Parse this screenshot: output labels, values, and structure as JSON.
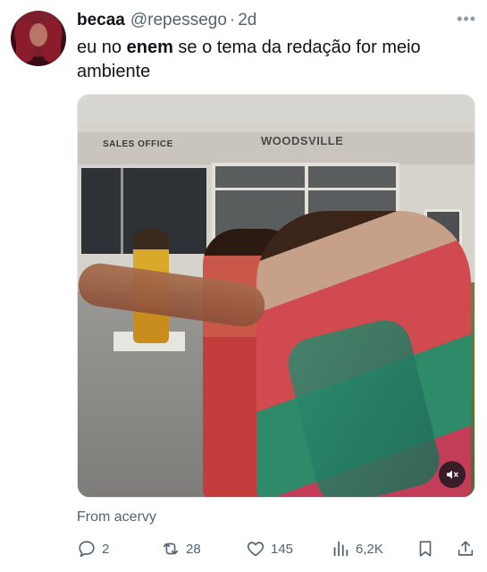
{
  "tweet": {
    "author_name": "becaa",
    "handle": "@repessego",
    "separator": "·",
    "time": "2d",
    "more": "•••",
    "text_before": "eu no ",
    "text_bold": "enem",
    "text_after": " se o tema da redação for meio ambiente",
    "video": {
      "sign_office": "SALES OFFICE",
      "sign_brand": "WOODSVILLE",
      "muted": true
    },
    "from_label": "From acervy"
  },
  "actions": {
    "replies": "2",
    "reposts": "28",
    "likes": "145",
    "views": "6,2K"
  },
  "colors": {
    "text": "#0f1419",
    "secondary": "#536471"
  }
}
